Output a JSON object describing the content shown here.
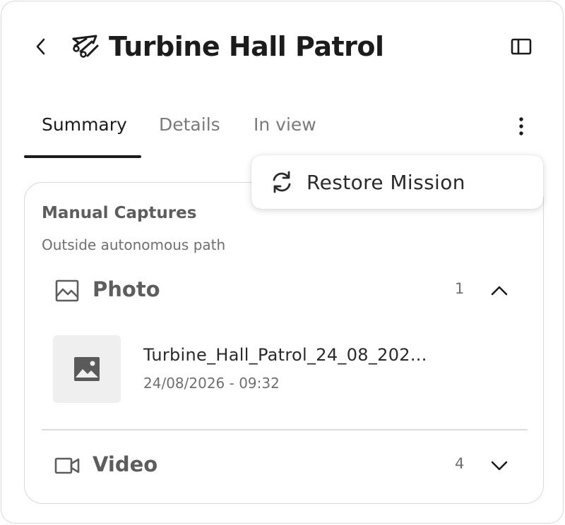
{
  "header": {
    "title": "Turbine Hall Patrol",
    "back_icon": "chevron-left-icon",
    "mission_icon": "drone-route-icon",
    "panel_icon": "sidebar-panel-icon"
  },
  "tabs": [
    {
      "label": "Summary",
      "active": true
    },
    {
      "label": "Details",
      "active": false
    },
    {
      "label": "In view",
      "active": false
    }
  ],
  "more_icon": "more-vertical-icon",
  "menu": {
    "items": [
      {
        "label": "Restore Mission",
        "icon": "restore-icon"
      }
    ]
  },
  "captures": {
    "title": "Manual Captures",
    "subtitle": "Outside autonomous path",
    "sections": [
      {
        "label": "Photo",
        "count": "1",
        "icon": "image-icon",
        "expanded": true,
        "items": [
          {
            "name": "Turbine_Hall_Patrol_24_08_202...",
            "date": "24/08/2026 - 09:32",
            "thumb_icon": "image-placeholder-icon"
          }
        ]
      },
      {
        "label": "Video",
        "count": "4",
        "icon": "video-icon",
        "expanded": false
      }
    ]
  },
  "colors": {
    "text_primary": "#1c1c1c",
    "text_secondary": "#6f6f6f",
    "border": "#d9d9d9",
    "thumb_bg": "#efefef"
  }
}
